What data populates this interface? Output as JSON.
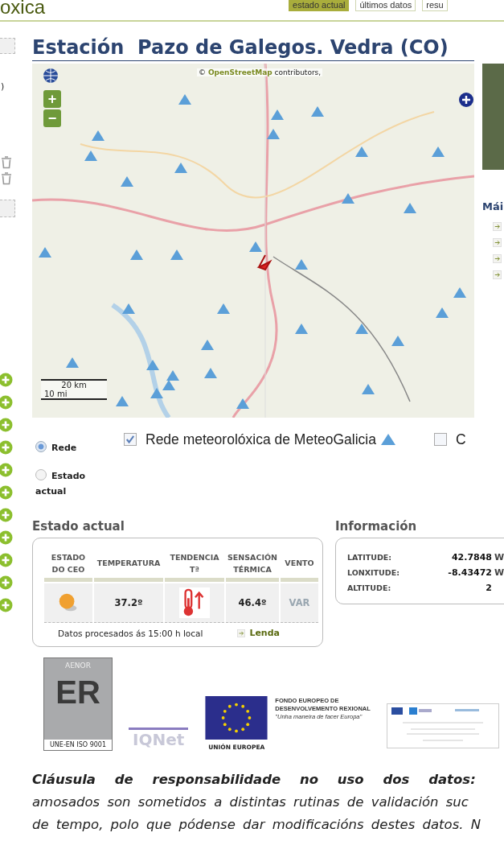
{
  "header": {
    "site_title": "oxica",
    "tabs": [
      {
        "label": "estado actual",
        "selected": true
      },
      {
        "label": "últimos datos",
        "selected": false
      },
      {
        "label": "resu",
        "selected": false
      }
    ]
  },
  "left_rail": {
    "fragment": ")"
  },
  "station": {
    "title": "Estación  Pazo de Galegos. Vedra (CO)"
  },
  "map": {
    "attribution_prefix": "©",
    "attribution_link": "OpenStreetMap",
    "attribution": "contributors,",
    "zoom": [
      "+",
      "−"
    ],
    "scale": [
      "20 km",
      "10 mi"
    ]
  },
  "side_panel": {
    "heading": "Mái"
  },
  "view_options": [
    {
      "label": "Rede",
      "selected": true
    },
    {
      "label": "Estado actual",
      "selected": false
    }
  ],
  "layers": [
    {
      "label": "Rede meteorolóxica de MeteoGalicia",
      "checked": true
    },
    {
      "label": "C",
      "checked": false
    }
  ],
  "current": {
    "title": "Estado actual",
    "columns": [
      "ESTADO DO CEO",
      "TEMPERATURA",
      "TENDENCIA Tª",
      "SENSACIÓN TÉRMICA",
      "VENTO"
    ],
    "cells": [
      {
        "kind": "sky"
      },
      {
        "kind": "text",
        "value": "37.2º"
      },
      {
        "kind": "trend"
      },
      {
        "kind": "text",
        "value": "46.4º"
      },
      {
        "kind": "wind",
        "value": "VAR"
      }
    ],
    "note": "Datos procesados ás 15:00 h local",
    "legend_link": "Lenda"
  },
  "info": {
    "title": "Información",
    "rows": [
      {
        "label": "LATITUDE:",
        "value": "42.7848",
        "unit": "W"
      },
      {
        "label": "LONXITUDE:",
        "value": "-8.43472",
        "unit": "W"
      },
      {
        "label": "ALTITUDE:",
        "value": "2"
      }
    ]
  },
  "logos": {
    "aenor": "AENOR",
    "aenor_mark": "ER",
    "aenor_cert": "UNE-EN ISO 9001",
    "iqnet": "IQNet",
    "eu": "UNIÓN EUROPEA",
    "feder": [
      "FONDO EUROPEO DE",
      "DESENVOLVEMENTO REXIONAL"
    ],
    "motto": "\"Unha maneira de facer Europa\""
  },
  "disclaimer": {
    "lead": "Cláusula de responsabilidade no uso dos datos:",
    "lines": [
      "amosados son sometidos a distintas rutinas de validación suc",
      "de tempo, polo que pódense dar modificacións destes datos. N"
    ]
  }
}
